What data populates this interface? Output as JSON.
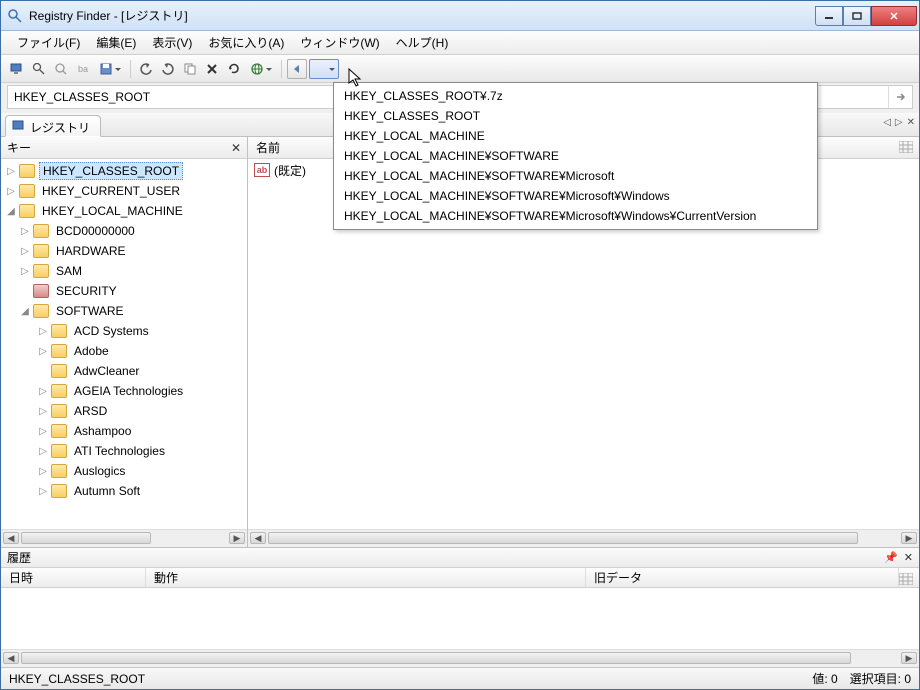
{
  "titlebar": {
    "title": "Registry Finder - [レジストリ]"
  },
  "menubar": {
    "items": [
      "ファイル(F)",
      "編集(E)",
      "表示(V)",
      "お気に入り(A)",
      "ウィンドウ(W)",
      "ヘルプ(H)"
    ]
  },
  "addressbar": {
    "value": "HKEY_CLASSES_ROOT"
  },
  "tab": {
    "label": "レジストリ"
  },
  "left_panel": {
    "header": "キー"
  },
  "tree": {
    "items": [
      {
        "label": "HKEY_CLASSES_ROOT",
        "indent": 0,
        "exp": "▷",
        "selected": true
      },
      {
        "label": "HKEY_CURRENT_USER",
        "indent": 0,
        "exp": "▷"
      },
      {
        "label": "HKEY_LOCAL_MACHINE",
        "indent": 0,
        "exp": "◢"
      },
      {
        "label": "BCD00000000",
        "indent": 1,
        "exp": "▷"
      },
      {
        "label": "HARDWARE",
        "indent": 1,
        "exp": "▷"
      },
      {
        "label": "SAM",
        "indent": 1,
        "exp": "▷"
      },
      {
        "label": "SECURITY",
        "indent": 1,
        "exp": "",
        "sec": true
      },
      {
        "label": "SOFTWARE",
        "indent": 1,
        "exp": "◢"
      },
      {
        "label": "ACD Systems",
        "indent": 2,
        "exp": "▷"
      },
      {
        "label": "Adobe",
        "indent": 2,
        "exp": "▷"
      },
      {
        "label": "AdwCleaner",
        "indent": 2,
        "exp": ""
      },
      {
        "label": "AGEIA Technologies",
        "indent": 2,
        "exp": "▷"
      },
      {
        "label": "ARSD",
        "indent": 2,
        "exp": "▷"
      },
      {
        "label": "Ashampoo",
        "indent": 2,
        "exp": "▷"
      },
      {
        "label": "ATI Technologies",
        "indent": 2,
        "exp": "▷"
      },
      {
        "label": "Auslogics",
        "indent": 2,
        "exp": "▷"
      },
      {
        "label": "Autumn Soft",
        "indent": 2,
        "exp": "▷"
      }
    ]
  },
  "right_panel": {
    "header": "名前",
    "row0_icon": "ab",
    "row0_label": "(既定)"
  },
  "history_dropdown": {
    "items": [
      "HKEY_CLASSES_ROOT¥.7z",
      "HKEY_CLASSES_ROOT",
      "HKEY_LOCAL_MACHINE",
      "HKEY_LOCAL_MACHINE¥SOFTWARE",
      "HKEY_LOCAL_MACHINE¥SOFTWARE¥Microsoft",
      "HKEY_LOCAL_MACHINE¥SOFTWARE¥Microsoft¥Windows",
      "HKEY_LOCAL_MACHINE¥SOFTWARE¥Microsoft¥Windows¥CurrentVersion"
    ]
  },
  "history_panel": {
    "title": "履歴",
    "cols": [
      "日時",
      "動作",
      "旧データ"
    ]
  },
  "statusbar": {
    "path": "HKEY_CLASSES_ROOT",
    "values_label": "値: 0",
    "selected_label": "選択項目: 0"
  }
}
